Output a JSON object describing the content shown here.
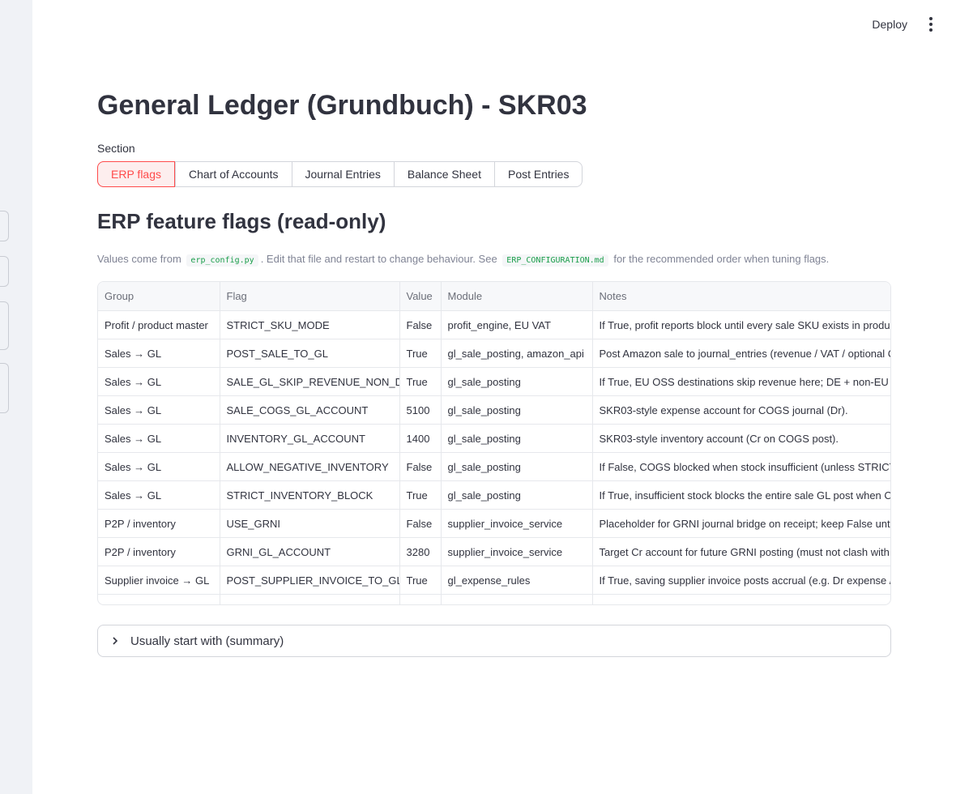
{
  "topbar": {
    "deploy_label": "Deploy"
  },
  "page": {
    "title": "General Ledger (Grundbuch) - SKR03"
  },
  "section": {
    "label": "Section",
    "options": [
      "ERP flags",
      "Chart of Accounts",
      "Journal Entries",
      "Balance Sheet",
      "Post Entries"
    ],
    "selected": "ERP flags"
  },
  "flags": {
    "heading": "ERP feature flags (read-only)",
    "caption": {
      "part1": "Values come from",
      "file1": "erp_config.py",
      "part2": ". Edit that file and restart to change behaviour. See",
      "file2": "ERP_CONFIGURATION.md",
      "part3": "for the recommended order when tuning flags."
    }
  },
  "table": {
    "columns": [
      "Group",
      "Flag",
      "Value",
      "Module",
      "Notes"
    ],
    "rows": [
      [
        "Profit / product master",
        "STRICT_SKU_MODE",
        "False",
        "profit_engine, EU VAT",
        "If True, profit reports block until every sale SKU exists in product master"
      ],
      [
        "Sales → GL",
        "POST_SALE_TO_GL",
        "True",
        "gl_sale_posting, amazon_api",
        "Post Amazon sale to journal_entries (revenue / VAT / optional COGS)"
      ],
      [
        "Sales → GL",
        "SALE_GL_SKIP_REVENUE_NON_DE",
        "True",
        "gl_sale_posting",
        "If True, EU OSS destinations skip revenue here; DE + non-EU export post"
      ],
      [
        "Sales → GL",
        "SALE_COGS_GL_ACCOUNT",
        "5100",
        "gl_sale_posting",
        "SKR03-style expense account for COGS journal (Dr)."
      ],
      [
        "Sales → GL",
        "INVENTORY_GL_ACCOUNT",
        "1400",
        "gl_sale_posting",
        "SKR03-style inventory account (Cr on COGS post)."
      ],
      [
        "Sales → GL",
        "ALLOW_NEGATIVE_INVENTORY",
        "False",
        "gl_sale_posting",
        "If False, COGS blocked when stock insufficient (unless STRICT_INVENTORY_BLOCK)"
      ],
      [
        "Sales → GL",
        "STRICT_INVENTORY_BLOCK",
        "True",
        "gl_sale_posting",
        "If True, insufficient stock blocks the entire sale GL post when COGS enabled"
      ],
      [
        "P2P / inventory",
        "USE_GRNI",
        "False",
        "supplier_invoice_service",
        "Placeholder for GRNI journal bridge on receipt; keep False until implemented"
      ],
      [
        "P2P / inventory",
        "GRNI_GL_ACCOUNT",
        "3280",
        "supplier_invoice_service",
        "Target Cr account for future GRNI posting (must not clash with AP account)"
      ],
      [
        "Supplier invoice → GL",
        "POST_SUPPLIER_INVOICE_TO_GL",
        "True",
        "gl_expense_rules",
        "If True, saving supplier invoice posts accrual (e.g. Dr expense / Cr AP)"
      ]
    ]
  },
  "expander": {
    "label": "Usually start with (summary)",
    "expanded": false
  }
}
